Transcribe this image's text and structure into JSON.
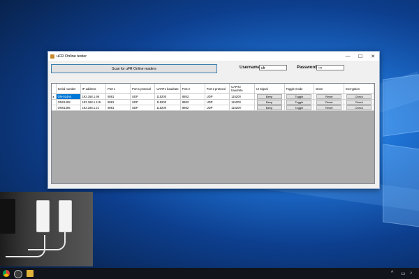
{
  "window": {
    "title": "uFR Online tester",
    "minimize": "—",
    "maximize": "☐",
    "close": "✕"
  },
  "controls": {
    "scan_button": "Scan for uFR Online readers",
    "username_label": "Username",
    "username_value": "ufr",
    "password_label": "Password",
    "password_value": "•••"
  },
  "grid": {
    "columns": [
      "Serial number",
      "IP address",
      "Port 1",
      "Port 1 protocol",
      "UART1 baudrate",
      "Port 2",
      "Port 2 protocol",
      "UART2 baudrate",
      "UI Signal",
      "Toggle mode",
      "Done",
      "Encryption"
    ],
    "rows": [
      {
        "serial": "ON-014A4",
        "ip": "192.168.1.98",
        "port1": "8881",
        "proto1": "UDP",
        "baud1": "115200",
        "port2": "8882",
        "proto2": "UDP",
        "baud2": "115200",
        "ui": "Beep",
        "toggle": "Toggle",
        "done": "Reset",
        "enc": "Check"
      },
      {
        "serial": "ON01408",
        "ip": "192.168.1.119",
        "port1": "8881",
        "proto1": "UDP",
        "baud1": "115200",
        "port2": "8882",
        "proto2": "UDP",
        "baud2": "115200",
        "ui": "Beep",
        "toggle": "Toggle",
        "done": "Reset",
        "enc": "Check"
      },
      {
        "serial": "ON01395",
        "ip": "192.168.1.21",
        "port1": "8881",
        "proto1": "UDP",
        "baud1": "115200",
        "port2": "8882",
        "proto2": "UDP",
        "baud2": "115200",
        "ui": "Beep",
        "toggle": "Toggle",
        "done": "Reset",
        "enc": "Check"
      }
    ]
  },
  "taskbar": {
    "icons": [
      "chrome-icon",
      "obs-icon",
      "file-explorer-icon"
    ],
    "tray_up": "^"
  },
  "colors": {
    "selection": "#0078d7",
    "desktop": "#1f74d6",
    "taskbar": "#11141a"
  }
}
